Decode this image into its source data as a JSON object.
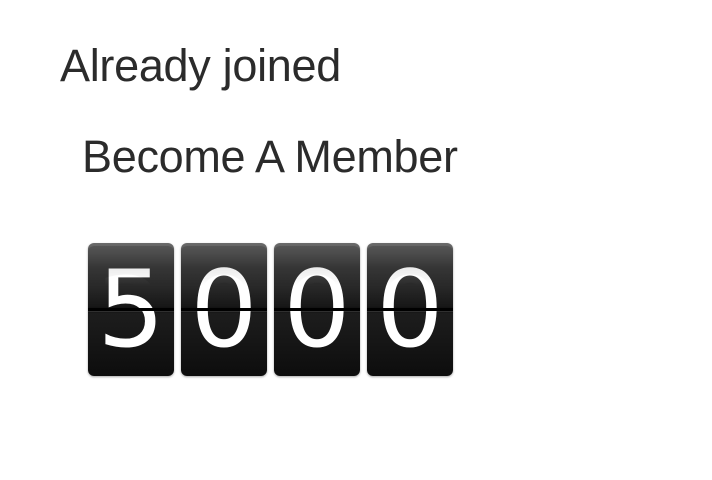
{
  "headline": "Already joined",
  "cta": "Become A Member",
  "counter": {
    "digits": [
      "5",
      "0",
      "0",
      "0"
    ]
  }
}
